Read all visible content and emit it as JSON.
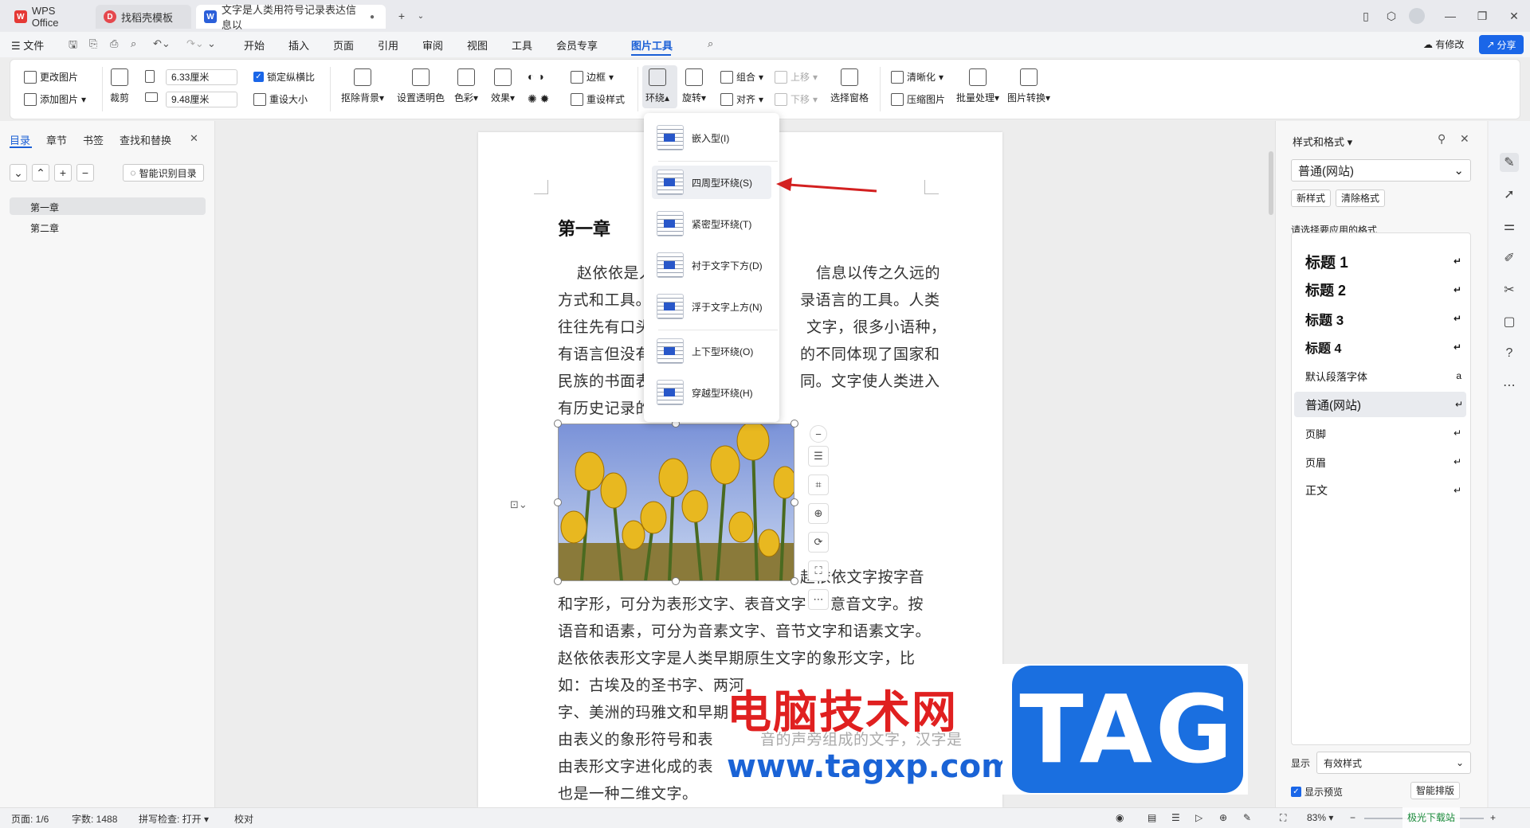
{
  "tabs": [
    {
      "label": "WPS Office"
    },
    {
      "label": "找稻壳模板"
    },
    {
      "label": "文字是人类用符号记录表达信息以"
    }
  ],
  "menu": {
    "file": "文件",
    "items": [
      "开始",
      "插入",
      "页面",
      "引用",
      "审阅",
      "视图",
      "工具",
      "会员专享",
      "图片工具"
    ],
    "has_changes": "有修改",
    "share": "分享"
  },
  "ribbon": {
    "change_pic": "更改图片",
    "add_pic": "添加图片",
    "crop": "裁剪",
    "width": "6.33厘米",
    "height": "9.48厘米",
    "lock_ratio": "锁定纵横比",
    "reset_size": "重设大小",
    "remove_bg": "抠除背景",
    "set_transparent": "设置透明色",
    "color": "色彩",
    "effect": "效果",
    "border": "边框",
    "reset_style": "重设样式",
    "wrap": "环绕",
    "rotate": "旋转",
    "group": "组合",
    "align": "对齐",
    "up": "上移",
    "down": "下移",
    "selection_pane": "选择窗格",
    "sharpen": "清晰化",
    "compress": "压缩图片",
    "batch": "批量处理",
    "convert": "图片转换"
  },
  "left_panel": {
    "tabs": [
      "目录",
      "章节",
      "书签",
      "查找和替换"
    ],
    "smart_toc": "智能识别目录",
    "toc": [
      "第一章",
      "第二章"
    ]
  },
  "document": {
    "heading": "第一章",
    "lines": [
      "赵依依是人",
      "信息以传之久远的",
      "方式和工具。",
      "录语言的工具。人类",
      "往往先有口头",
      "文字，很多小语种，",
      "有语言但没有",
      "的不同体现了国家和",
      "民族的书面表",
      "同。文字使人类进入",
      "有历史记录的"
    ],
    "lines_after": [
      "赵依依文字按字音",
      "和字形，可分为表形文字、表音文字",
      "意音文字。按",
      "语音和语素，可分为音素文字、音节文字和语素文字。",
      "赵依依表形文字是人类早期原生文字的象形文字，比",
      "如：古埃及的圣书字、两河",
      "字、美洲的玛雅文和早期",
      "由表义的象形符号和表",
      "音的声旁组成的文字，汉字是",
      "由表形文字进化成的表",
      "也是一种二维文字。"
    ]
  },
  "wrap_menu": {
    "items": [
      "嵌入型(I)",
      "四周型环绕(S)",
      "紧密型环绕(T)",
      "衬于文字下方(D)",
      "浮于文字上方(N)",
      "上下型环绕(O)",
      "穿越型环绕(H)"
    ],
    "highlighted": "四周型环绕(S)"
  },
  "right_panel": {
    "title": "样式和格式",
    "current_style": "普通(网站)",
    "new_style": "新样式",
    "clear_format": "清除格式",
    "prompt": "请选择要应用的格式",
    "styles": [
      "标题 1",
      "标题 2",
      "标题 3",
      "标题 4",
      "默认段落字体",
      "普通(网站)",
      "页脚",
      "页眉",
      "正文"
    ],
    "show_label": "显示",
    "show_value": "有效样式",
    "preview": "显示预览",
    "smart_format": "智能排版"
  },
  "status": {
    "page": "页面: 1/6",
    "words": "字数: 1488",
    "spell": "拼写检查: 打开",
    "proof": "校对",
    "zoom": "83%"
  },
  "watermark": {
    "site": "电脑技术网",
    "url": "www.tagxp.com",
    "tag": "TAG",
    "corner": "极光下载站"
  },
  "colors": {
    "accent": "#1a5fd6",
    "share_bg": "#1a66e8",
    "arrow": "#d32020"
  }
}
